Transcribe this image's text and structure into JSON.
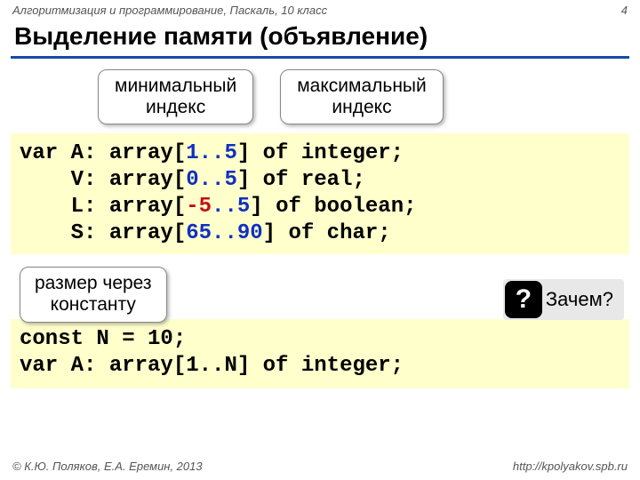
{
  "header": {
    "course": "Алгоритмизация и программирование, Паскаль, 10 класс",
    "page": "4"
  },
  "title": "Выделение памяти (объявление)",
  "labels": {
    "min_index": "минимальный\nиндекс",
    "max_index": "максимальный\nиндекс",
    "via_const": "размер через\nконстанту"
  },
  "code1": {
    "l1_a": "var A: array[",
    "l1_r": "1..5",
    "l1_b": "] of integer;",
    "l2_a": "    V: array[",
    "l2_r": "0..5",
    "l2_b": "] of real;",
    "l3_a": "    L: array[",
    "l3_m": "-5",
    "l3_r": "..5",
    "l3_b": "] of boolean;",
    "l4_a": "    S: array[",
    "l4_r": "65..90",
    "l4_b": "] of char;"
  },
  "code2": {
    "l1": "const N = 10;",
    "l2_a": "var A: array[",
    "l2_r": "1..N",
    "l2_b": "] of integer;"
  },
  "question": {
    "mark": "?",
    "text": "Зачем?"
  },
  "footer": {
    "left": "© К.Ю. Поляков, Е.А. Еремин, 2013",
    "right": "http://kpolyakov.spb.ru"
  }
}
